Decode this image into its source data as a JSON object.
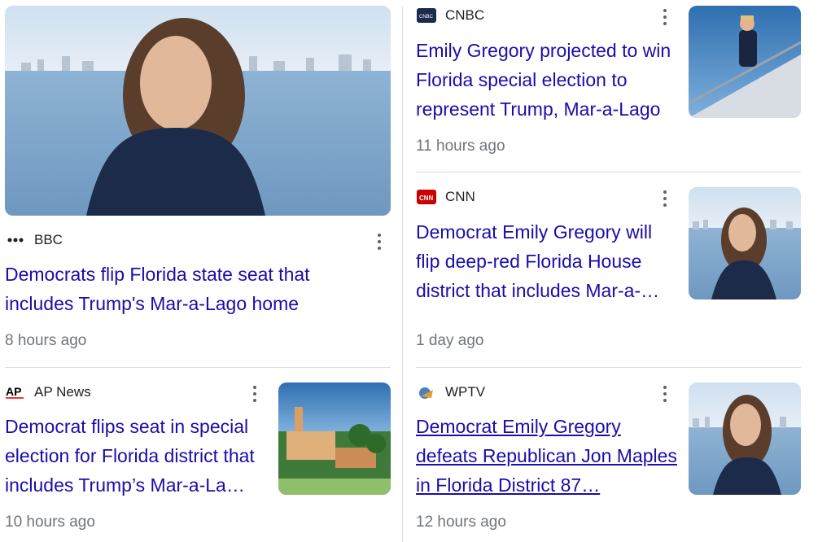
{
  "articles": [
    {
      "source": "BBC",
      "logo": "ellipsis-logo-icon",
      "title": "Democrats flip Florida state seat that includes Trump's Mar-a-Lago home",
      "time": "8 hours ago",
      "image": "woman-by-water"
    },
    {
      "source": "CNBC",
      "logo": "cnbc-logo-icon",
      "title": "Emily Gregory projected to win Florida special election to represent Trump, Mar-a-Lago",
      "time": "11 hours ago",
      "image": "trump-on-stairs"
    },
    {
      "source": "CNN",
      "logo": "cnn-logo-icon",
      "title": "Democrat Emily Gregory will flip deep-red Florida House district that includes Mar-a-…",
      "time": "1 day ago",
      "image": "woman-by-water"
    },
    {
      "source": "AP News",
      "logo": "ap-logo-icon",
      "title": "Democrat flips seat in special election for Florida district that includes Trump’s Mar-a-La…",
      "time": "10 hours ago",
      "image": "mar-a-lago-aerial"
    },
    {
      "source": "WPTV",
      "logo": "wptv-logo-icon",
      "title": "Democrat Emily Gregory defeats Republican Jon Maples in Florida District 87…",
      "time": "12 hours ago",
      "image": "woman-by-water"
    }
  ],
  "colors": {
    "link": "#1a0dab",
    "meta": "#70757a",
    "divider": "#dadce0"
  }
}
